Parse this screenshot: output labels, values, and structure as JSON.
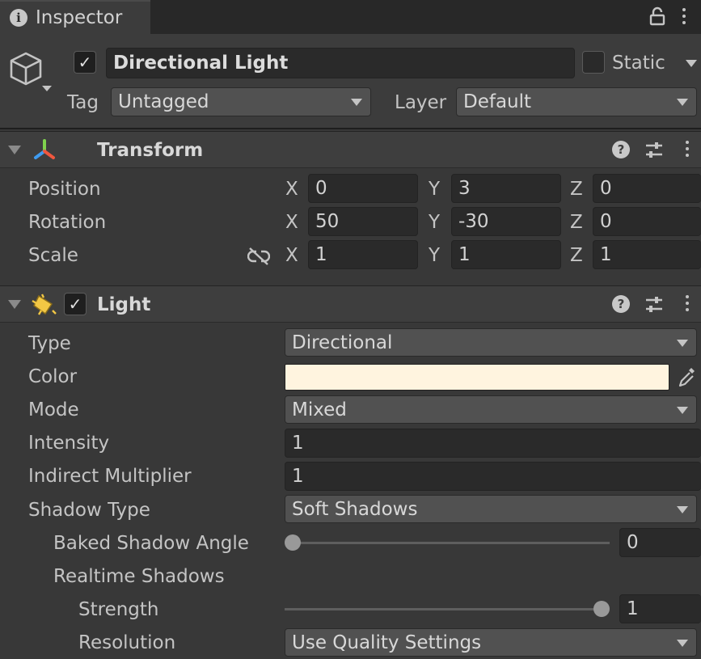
{
  "tab": {
    "title": "Inspector"
  },
  "object": {
    "name": "Directional Light",
    "static_label": "Static",
    "tag_label": "Tag",
    "tag_value": "Untagged",
    "layer_label": "Layer",
    "layer_value": "Default",
    "active": true,
    "static": false
  },
  "transform": {
    "title": "Transform",
    "rows": [
      {
        "label": "Position",
        "x": "0",
        "y": "3",
        "z": "0"
      },
      {
        "label": "Rotation",
        "x": "50",
        "y": "-30",
        "z": "0"
      },
      {
        "label": "Scale",
        "x": "1",
        "y": "1",
        "z": "1"
      }
    ],
    "axis": {
      "x": "X",
      "y": "Y",
      "z": "Z"
    }
  },
  "light": {
    "title": "Light",
    "enabled": true,
    "type_label": "Type",
    "type_value": "Directional",
    "color_label": "Color",
    "color_value": "#fff4df",
    "mode_label": "Mode",
    "mode_value": "Mixed",
    "intensity_label": "Intensity",
    "intensity_value": "1",
    "indirect_label": "Indirect Multiplier",
    "indirect_value": "1",
    "shadow_type_label": "Shadow Type",
    "shadow_type_value": "Soft Shadows",
    "baked_angle_label": "Baked Shadow Angle",
    "baked_angle_value": "0",
    "baked_angle_fraction": 0.0,
    "realtime_label": "Realtime Shadows",
    "strength_label": "Strength",
    "strength_value": "1",
    "strength_fraction": 1.0,
    "resolution_label": "Resolution",
    "resolution_value": "Use Quality Settings"
  },
  "icons": [
    "info-icon",
    "lock-icon",
    "menu-dots-icon",
    "cube-icon",
    "transform-axes-icon",
    "light-icon",
    "help-icon",
    "preset-icon",
    "unlink-icon",
    "eyedropper-icon",
    "foldout-arrow-icon",
    "dropdown-arrow-icon",
    "checkmark-icon"
  ]
}
